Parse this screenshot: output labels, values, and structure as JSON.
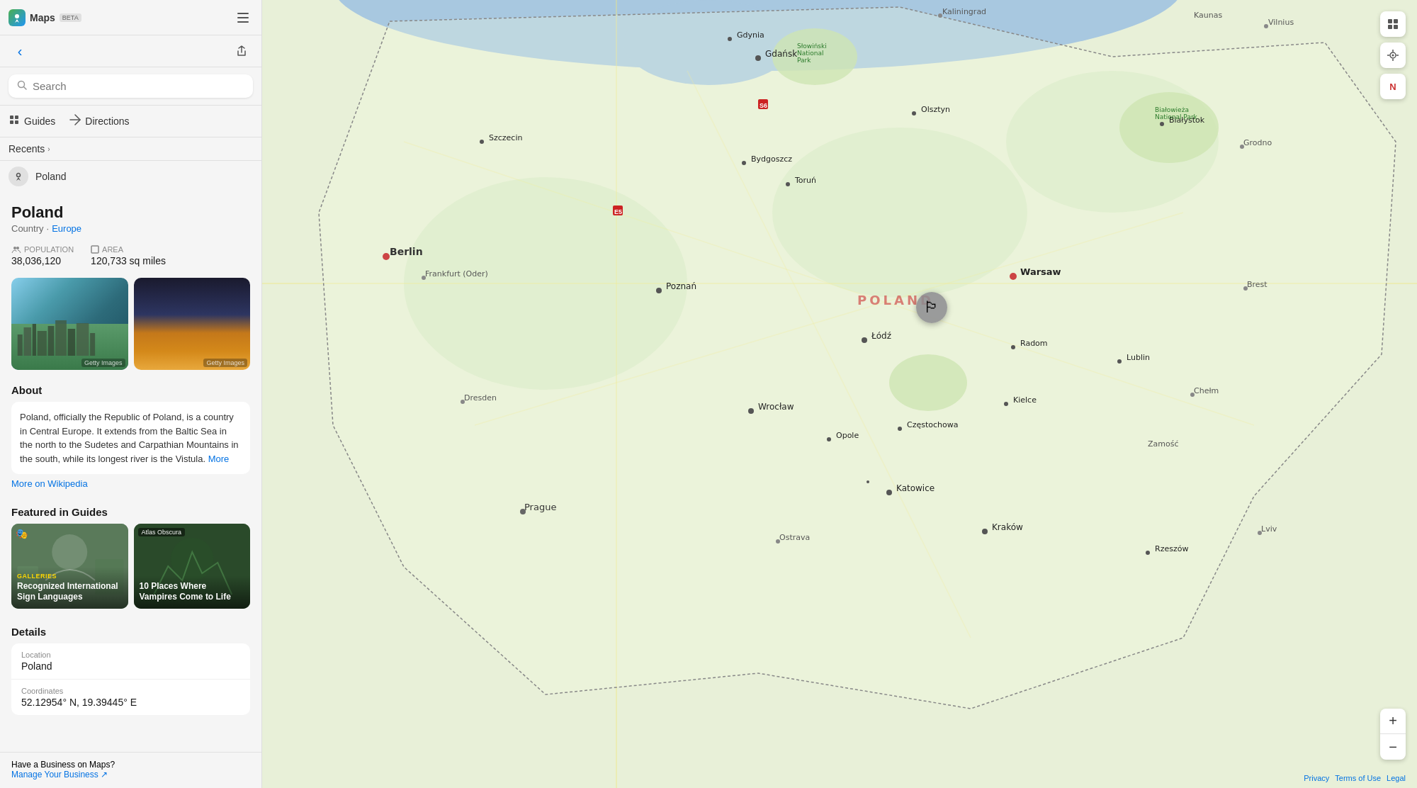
{
  "app": {
    "name": "Maps",
    "beta_label": "BETA",
    "logo_icon": "🗺"
  },
  "toolbar": {
    "back_button": "‹",
    "share_button": "⬆"
  },
  "search": {
    "placeholder": "Search",
    "label": "Search"
  },
  "nav": {
    "guides_label": "Guides",
    "directions_label": "Directions",
    "guides_icon": "⊞",
    "directions_icon": "→"
  },
  "recents": {
    "label": "Recents",
    "chevron": "›",
    "items": [
      {
        "name": "Poland",
        "icon": "📍"
      }
    ]
  },
  "place": {
    "title": "Poland",
    "subtitle_type": "Country",
    "subtitle_link_text": "Europe",
    "subtitle_separator": "·",
    "population_label": "POPULATION",
    "population_icon": "👥",
    "population_value": "38,036,120",
    "area_label": "AREA",
    "area_icon": "⬜",
    "area_value": "120,733 sq miles",
    "about_title": "About",
    "about_text": "Poland, officially the Republic of Poland, is a country in Central Europe. It extends from the Baltic Sea in the north to the Sudetes and Carpathian Mountains in the south, while its longest river is the Vistula.",
    "about_more": "More",
    "wikipedia_link": "More on Wikipedia",
    "featured_title": "Featured in Guides",
    "guides": [
      {
        "label": "GALLERIES",
        "title": "Recognized International Sign Languages",
        "bg_class": "guide-card-bg-1",
        "has_gallery_icon": true
      },
      {
        "label": "Atlas Obscura",
        "title": "10 Places Where Vampires Come to Life",
        "bg_class": "guide-card-bg-2",
        "has_atlas_badge": true
      }
    ],
    "details_title": "Details",
    "location_label": "Location",
    "location_value": "Poland",
    "coordinates_label": "Coordinates",
    "coordinates_value": "52.12954° N, 19.39445° E"
  },
  "footer": {
    "business_text": "Have a Business on Maps?",
    "manage_link": "Manage Your Business ↗"
  },
  "map": {
    "flag_emoji": "🏳",
    "country_label": "POLAND",
    "zoom_in_label": "+",
    "zoom_out_label": "−",
    "attribution": {
      "privacy": "Privacy",
      "terms": "Terms of Use",
      "legal": "Legal"
    },
    "controls": {
      "layers_icon": "⊞",
      "location_icon": "◎",
      "compass_label": "N"
    }
  }
}
